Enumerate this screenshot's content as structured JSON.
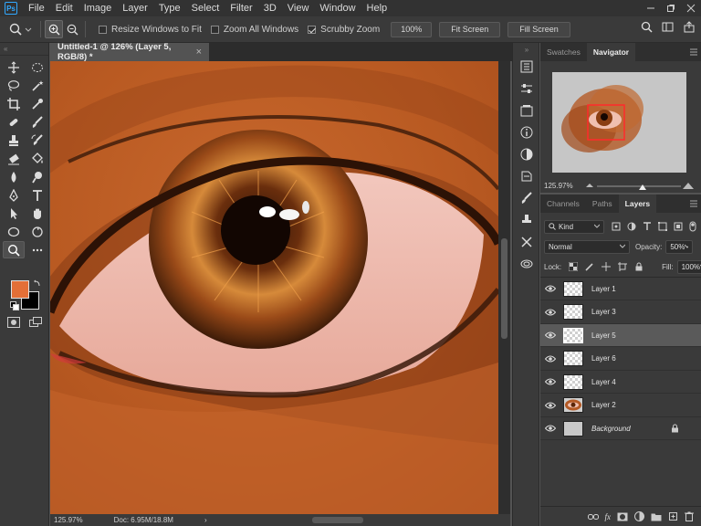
{
  "app": {
    "logo_text": "Ps",
    "menu": [
      "File",
      "Edit",
      "Image",
      "Layer",
      "Type",
      "Select",
      "Filter",
      "3D",
      "View",
      "Window",
      "Help"
    ],
    "window_controls": [
      "minimize-icon",
      "restore-icon",
      "close-icon"
    ]
  },
  "options_bar": {
    "resize_windows": {
      "label": "Resize Windows to Fit",
      "checked": false
    },
    "zoom_all": {
      "label": "Zoom All Windows",
      "checked": false
    },
    "scrubby_zoom": {
      "label": "Scrubby Zoom",
      "checked": true
    },
    "zoom_value": "100%",
    "fit_screen": "Fit Screen",
    "fill_screen": "Fill Screen"
  },
  "tools": {
    "grip": "«",
    "foreground_color": "#e36f37",
    "background_color": "#000000"
  },
  "document": {
    "tab_title": "Untitled-1 @ 126% (Layer 5, RGB/8) *",
    "close": "×",
    "status_zoom": "125.97%",
    "status_doc": "Doc: 6.95M/18.8M",
    "status_arrow": "›"
  },
  "navigator_panel": {
    "tabs": [
      "Swatches",
      "Navigator"
    ],
    "active_tab": "Navigator",
    "zoom": "125.97%"
  },
  "layers_panel": {
    "tabs": [
      "Channels",
      "Paths",
      "Layers"
    ],
    "active_tab": "Layers",
    "filter_kind": "Kind",
    "blend_mode": "Normal",
    "opacity_label": "Opacity:",
    "opacity": "50%",
    "lock_label": "Lock:",
    "fill_label": "Fill:",
    "fill": "100%",
    "layers": [
      {
        "name": "Layer 1",
        "selected": false,
        "thumb": "transparent"
      },
      {
        "name": "Layer 3",
        "selected": false,
        "thumb": "transparent"
      },
      {
        "name": "Layer 5",
        "selected": true,
        "thumb": "transparent"
      },
      {
        "name": "Layer 6",
        "selected": false,
        "thumb": "transparent"
      },
      {
        "name": "Layer 4",
        "selected": false,
        "thumb": "transparent"
      },
      {
        "name": "Layer 2",
        "selected": false,
        "thumb": "eye"
      },
      {
        "name": "Background",
        "selected": false,
        "thumb": "gray"
      }
    ]
  }
}
